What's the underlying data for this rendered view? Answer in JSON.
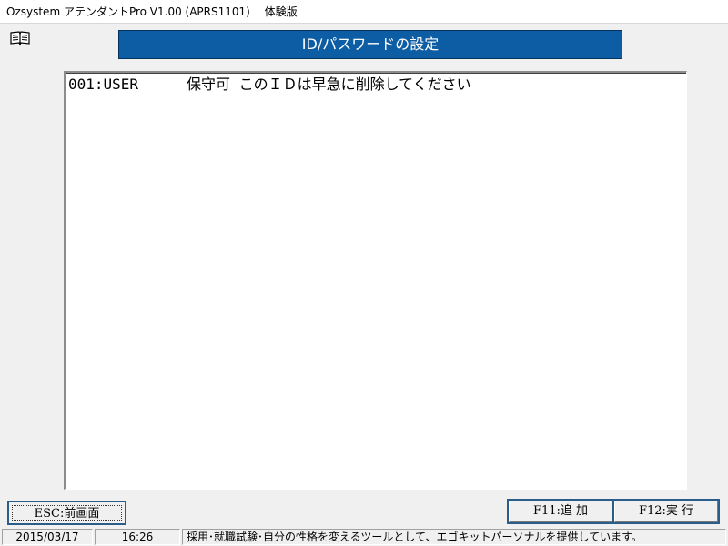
{
  "window": {
    "title": "Ozsystem アテンダントPro V1.00 (APRS1101)　 体験版"
  },
  "header": {
    "title": "ID/パスワードの設定",
    "bg_color": "#0d5da4"
  },
  "icons": {
    "help": "book-icon"
  },
  "list": {
    "rows": [
      {
        "id": "001:USER",
        "text": "保守可 このＩＤは早急に削除してください"
      }
    ]
  },
  "buttons": {
    "esc": "ESC:前画面",
    "f11": "F11:追 加",
    "f12": "F12:実 行"
  },
  "status": {
    "date": "2015/03/17",
    "time": "16:26",
    "message": "採用･就職試験･自分の性格を変えるツールとして、エゴキットパーソナルを提供しています。"
  }
}
